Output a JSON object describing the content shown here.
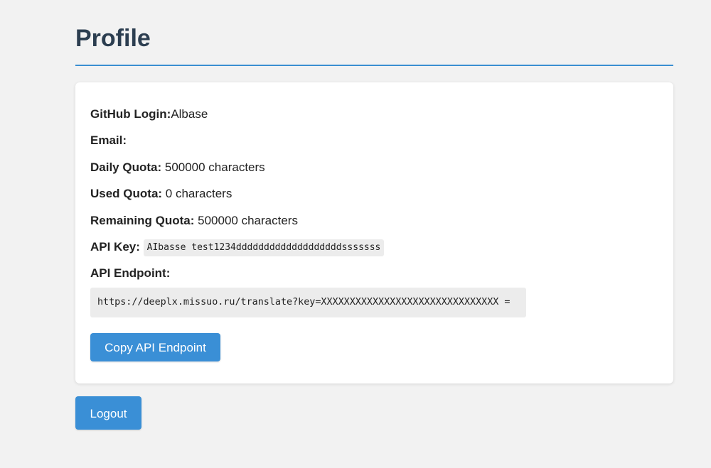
{
  "header": {
    "title": "Profile"
  },
  "profile": {
    "github_login_label": "GitHub Login:",
    "github_login_value": "Albase",
    "email_label": "Email:",
    "email_value": "",
    "daily_quota_label": "Daily Quota:",
    "daily_quota_value": "500000 characters",
    "used_quota_label": "Used Quota:",
    "used_quota_value": "0 characters",
    "remaining_quota_label": "Remaining Quota:",
    "remaining_quota_value": "500000 characters",
    "api_key_label": "API Key:",
    "api_key_value": "AIbasse test1234dddddddddddddddddddsssssss",
    "api_endpoint_label": "API Endpoint:",
    "api_endpoint_value": "https://deeplx.missuo.ru/translate?key=XXXXXXXXXXXXXXXXXXXXXXXXXXXXXXX ="
  },
  "buttons": {
    "copy_endpoint": "Copy API Endpoint",
    "logout": "Logout"
  },
  "colors": {
    "accent": "#3a8fd6",
    "title": "#2c3e50",
    "background": "#f2f2f2"
  }
}
